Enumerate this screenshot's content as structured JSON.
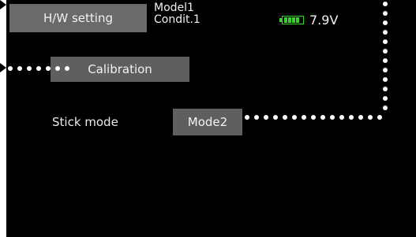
{
  "header": {
    "title_button": "H/W setting",
    "model_name": "Model1",
    "condition": "Condit.1",
    "voltage": "7.9V",
    "battery_icon": "battery-icon",
    "battery_color": "#39d12a"
  },
  "main": {
    "calibration_button": "Calibration",
    "stick_mode_label": "Stick mode",
    "stick_mode_value": "Mode2"
  },
  "colors": {
    "screen_bg": "#000000",
    "button_bg": "#5f5f5f",
    "callout": "#ffffff"
  }
}
